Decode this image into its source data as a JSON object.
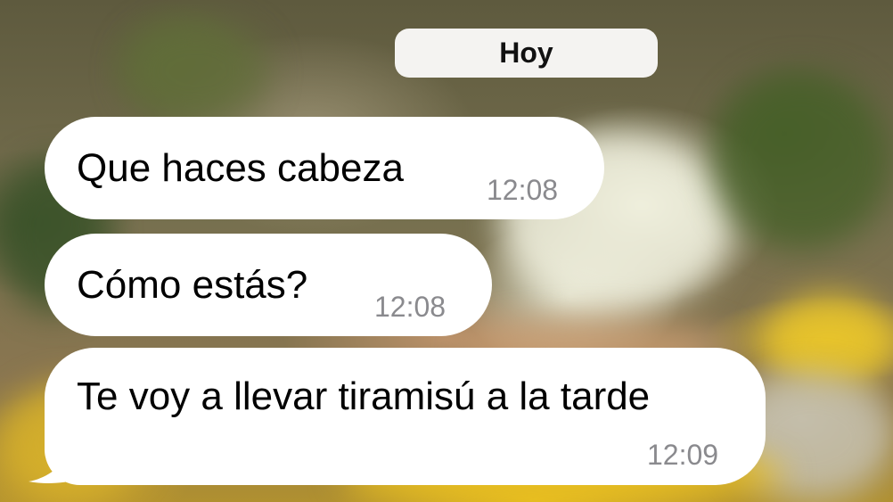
{
  "chat": {
    "date_separator": "Hoy",
    "messages": [
      {
        "text": "Que haces cabeza",
        "time": "12:08"
      },
      {
        "text": "Cómo estás?",
        "time": "12:08"
      },
      {
        "text": "Te voy a llevar tiramisú a la tarde",
        "time": "12:09"
      }
    ]
  },
  "colors": {
    "bubble": "#ffffff",
    "date_pill": "#f4f3f1",
    "timestamp": "#8a8a8e"
  }
}
